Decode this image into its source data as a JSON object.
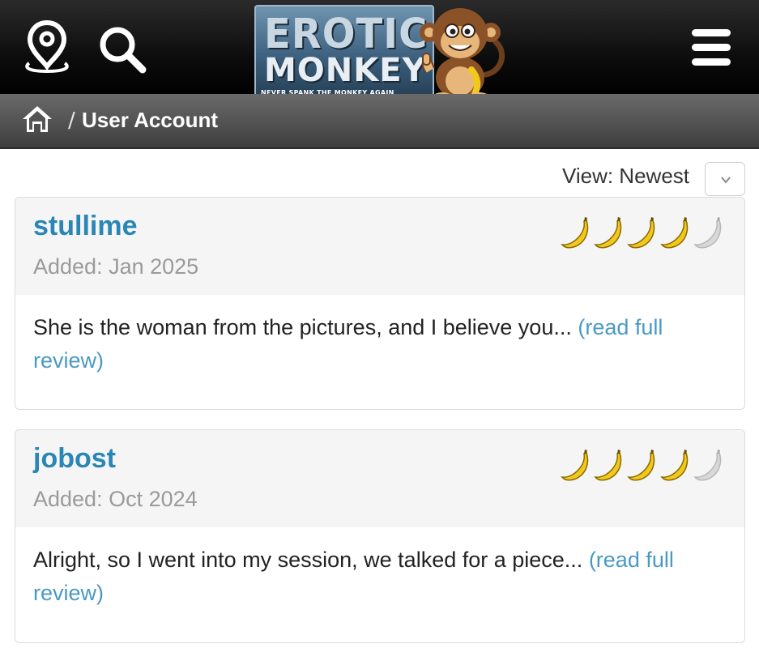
{
  "header": {
    "logo": {
      "word1": "EROTIC",
      "word2": "MONKEY",
      "tagline": "NEVER SPANK THE MONKEY AGAIN"
    },
    "icons": [
      "location-pin-icon",
      "search-icon",
      "hamburger-menu-icon"
    ]
  },
  "breadcrumb": {
    "separator": "/",
    "current": "User Account"
  },
  "view": {
    "label": "View: Newest"
  },
  "reviews": [
    {
      "name": "stullime",
      "added": "Added: Jan 2025",
      "excerpt": "She is the woman from the pictures, and I believe you... ",
      "link": "(read full review)",
      "rating": 4,
      "rating_max": 5
    },
    {
      "name": "jobost",
      "added": "Added: Oct 2024",
      "excerpt": "Alright, so I went into my session, we talked for a piece... ",
      "link": "(read full review)",
      "rating": 4,
      "rating_max": 5
    }
  ],
  "colors": {
    "link": "#2a86b5",
    "banana_on": "#f2c81d",
    "banana_off": "#d8d8d8"
  }
}
